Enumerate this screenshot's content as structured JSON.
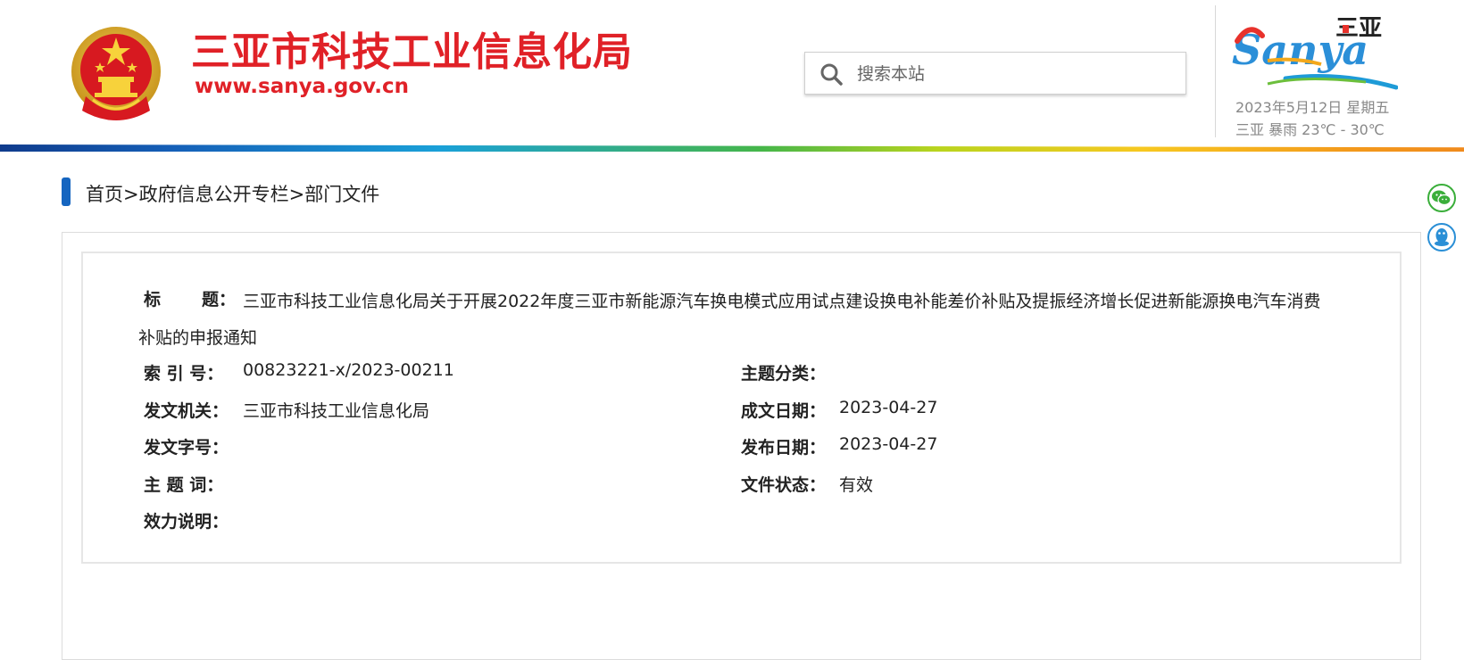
{
  "header": {
    "title": "三亚市科技工业信息化局",
    "url": "www.sanya.gov.cn",
    "search_placeholder": "搜索本站",
    "date": "2023年5月12日 星期五",
    "weather": "三亚  暴雨  23℃ - 30℃",
    "logo_text": "Sanya",
    "logo_chinese": "三亚"
  },
  "breadcrumb": {
    "home": "首页",
    "sep1": ">",
    "section": "政府信息公开专栏",
    "sep2": ">",
    "current": "部门文件"
  },
  "meta": {
    "title_label": "标    题：",
    "title_value": "三亚市科技工业信息化局关于开展2022年度三亚市新能源汽车换电模式应用试点建设换电补能差价补贴及提振经济增长促进新能源换电汽车消费补贴的申报通知",
    "index_label": "索 引 号：",
    "index_value": "00823221-x/2023-00211",
    "topic_label": "主题分类：",
    "topic_value": "",
    "issuer_label": "发文机关：",
    "issuer_value": "三亚市科技工业信息化局",
    "written_label": "成文日期：",
    "written_value": "2023-04-27",
    "docno_label": "发文字号：",
    "docno_value": "",
    "publish_label": "发布日期：",
    "publish_value": "2023-04-27",
    "keywords_label": "主 题 词：",
    "keywords_value": "",
    "status_label": "文件状态：",
    "status_value": "有效",
    "validity_label": "效力说明：",
    "validity_value": ""
  },
  "colors": {
    "brand_red": "#e02127",
    "accent_blue": "#1565c0",
    "wechat_green": "#3aae3a",
    "qq_blue": "#2a8fd6"
  },
  "icons": [
    "national-emblem-icon",
    "search-icon",
    "sanya-logo",
    "wechat-icon",
    "qq-icon"
  ]
}
